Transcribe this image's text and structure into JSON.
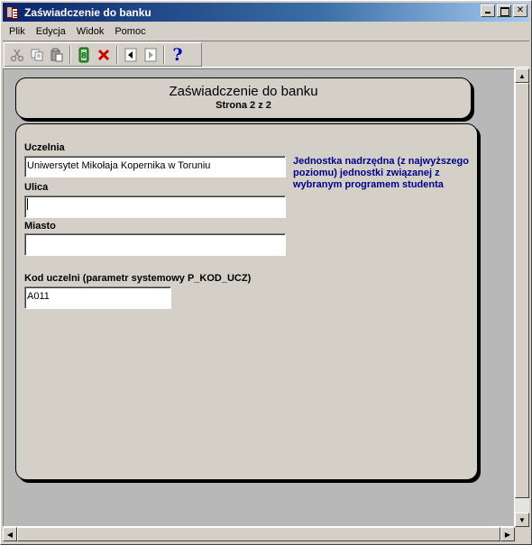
{
  "window": {
    "title": "Zaświadczenie do banku"
  },
  "menu": {
    "items": [
      "Plik",
      "Edycja",
      "Widok",
      "Pomoc"
    ]
  },
  "toolbar": {
    "icons": [
      "cut-icon",
      "copy-icon",
      "paste-icon",
      "query-icon",
      "delete-icon",
      "prev-icon",
      "next-icon",
      "help-icon"
    ],
    "help_glyph": "?"
  },
  "header": {
    "title": "Zaświadczenie do banku",
    "subtitle": "Strona 2 z 2"
  },
  "form": {
    "uczelnia_label": "Uczelnia",
    "uczelnia_value": "Uniwersytet Mikołaja Kopernika w Toruniu",
    "ulica_label": "Ulica",
    "ulica_value": "",
    "miasto_label": "Miasto",
    "miasto_value": "",
    "kod_label": "Kod uczelni (parametr systemowy P_KOD_UCZ)",
    "kod_value": "A011",
    "info_text": "Jednostka nadrzędna (z najwyższego poziomu) jednostki związanej z wybranym programem studenta"
  },
  "colors": {
    "titlebar_start": "#0a246a",
    "info_text": "#00008b",
    "face": "#d4d0c8"
  }
}
